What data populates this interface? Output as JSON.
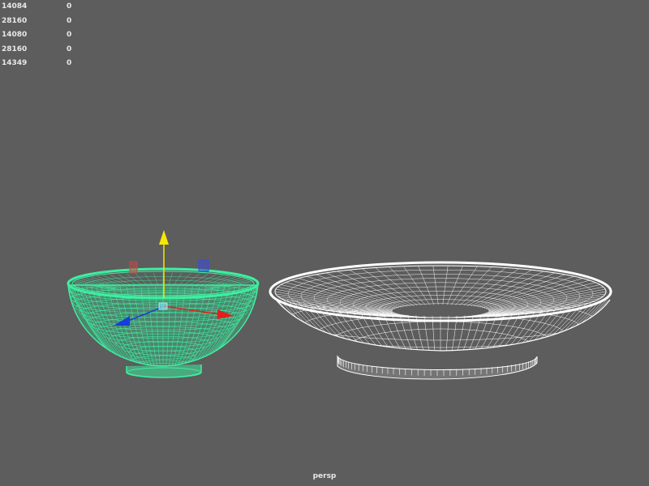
{
  "hud": {
    "rows": [
      {
        "left": "14084",
        "right": "0"
      },
      {
        "left": "28160",
        "right": "0"
      },
      {
        "left": "14080",
        "right": "0"
      },
      {
        "left": "28160",
        "right": "0"
      },
      {
        "left": "14349",
        "right": "0"
      }
    ]
  },
  "camera": {
    "label": "persp"
  },
  "colors": {
    "background": "#5d5d5d",
    "selected_wire": "#3df0a0",
    "unselected_wire": "#ffffff",
    "axis_x": "#e02020",
    "axis_y": "#f5e800",
    "axis_z": "#1a3cdc"
  }
}
